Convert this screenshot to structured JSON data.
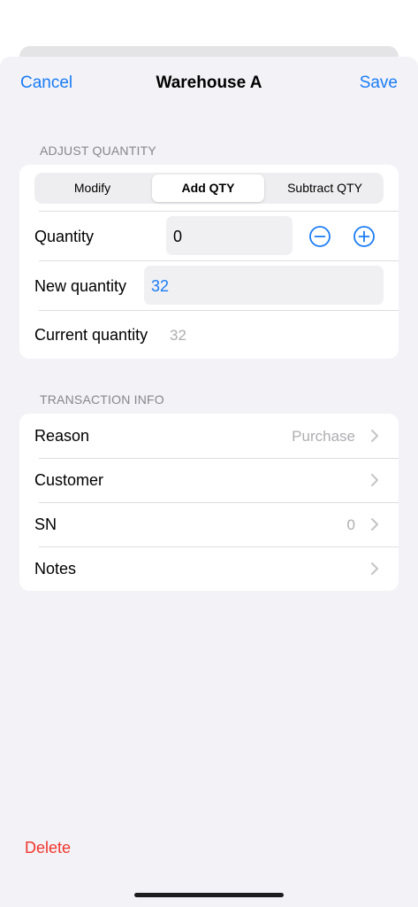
{
  "nav": {
    "cancel_label": "Cancel",
    "title": "Warehouse A",
    "save_label": "Save"
  },
  "adjust_quantity": {
    "header": "ADJUST QUANTITY",
    "segments": [
      "Modify",
      "Add QTY",
      "Subtract QTY"
    ],
    "selected_segment": "Add QTY",
    "quantity_label": "Quantity",
    "quantity_value": "0",
    "decrement_icon": "minus-circle-icon",
    "increment_icon": "plus-circle-icon",
    "new_quantity_label": "New quantity",
    "new_quantity_value": "32",
    "current_quantity_label": "Current quantity",
    "current_quantity_value": "32"
  },
  "transaction_info": {
    "header": "TRANSACTION INFO",
    "rows": [
      {
        "label": "Reason",
        "value": "Purchase"
      },
      {
        "label": "Customer",
        "value": ""
      },
      {
        "label": "SN",
        "value": "0"
      },
      {
        "label": "Notes",
        "value": ""
      }
    ]
  },
  "delete_label": "Delete",
  "colors": {
    "accent": "#1a7cf5",
    "destructive": "#f2352b",
    "background": "#f2f2f7",
    "muted_text": "#aeaeb2"
  }
}
